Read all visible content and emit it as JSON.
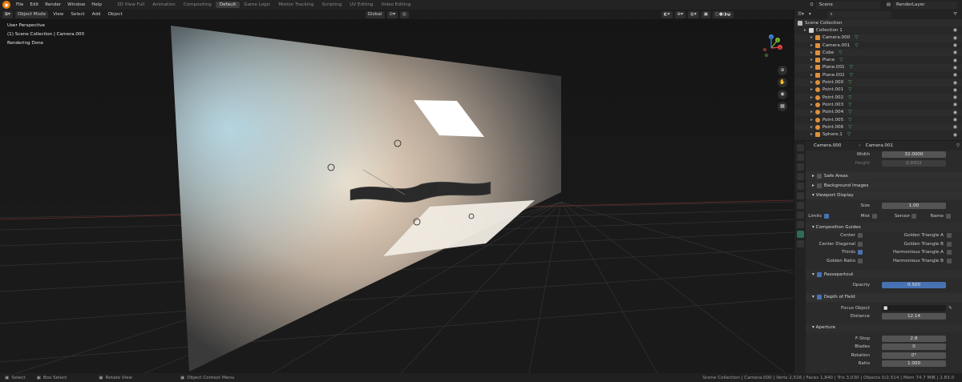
{
  "topbar": {
    "menus": [
      "File",
      "Edit",
      "Render",
      "Window",
      "Help"
    ],
    "workspaces": [
      "3D View Full",
      "Animation",
      "Compositing",
      "Default",
      "Game Logic",
      "Motion Tracking",
      "Scripting",
      "UV Editing",
      "Video Editing"
    ],
    "active_workspace": "Default",
    "scene": "Scene",
    "view_layer": "RenderLayer"
  },
  "viewport": {
    "mode": "Object Mode",
    "menus": [
      "View",
      "Select",
      "Add",
      "Object"
    ],
    "transform_orientation": "Global",
    "overlay_lines": [
      "User Perspective",
      "(1) Scene Collection | Camera.000",
      "Rendering Done"
    ],
    "gizmo_axes": [
      "X",
      "Y",
      "Z"
    ]
  },
  "statusbar": {
    "items": [
      "Select",
      "Box Select",
      "Rotate View",
      "Object Context Menu"
    ],
    "stats": "Scene Collection | Camera.000 | Verts 2,516 | Faces 1,840 | Tris 3,030 | Objects 0/2,514 | Mem 74.7 MiB | 2.83.0"
  },
  "outliner": {
    "root": "Scene Collection",
    "items": [
      {
        "name": "Collection 1",
        "type": "collection"
      },
      {
        "name": "Camera.000",
        "type": "camera"
      },
      {
        "name": "Camera.001",
        "type": "camera"
      },
      {
        "name": "Cube",
        "type": "mesh"
      },
      {
        "name": "Plane",
        "type": "mesh"
      },
      {
        "name": "Plane.001",
        "type": "mesh"
      },
      {
        "name": "Plane.002",
        "type": "mesh"
      },
      {
        "name": "Point.000",
        "type": "light"
      },
      {
        "name": "Point.001",
        "type": "light"
      },
      {
        "name": "Point.002",
        "type": "light"
      },
      {
        "name": "Point.003",
        "type": "light"
      },
      {
        "name": "Point.004",
        "type": "light"
      },
      {
        "name": "Point.005",
        "type": "light"
      },
      {
        "name": "Point.006",
        "type": "light"
      },
      {
        "name": "Sphere.1",
        "type": "mesh"
      }
    ]
  },
  "properties": {
    "object": "Camera.000",
    "data": "Camera.001",
    "width_label": "Width",
    "width_value": "32.0000",
    "height_label": "Height",
    "height_value": "0.8432",
    "panels": {
      "safe_areas": "Safe Areas",
      "background_images": "Background Images",
      "viewport_display": "Viewport Display",
      "composition_guides": "Composition Guides",
      "passepartout": "Passepartout",
      "depth_of_field": "Depth of Field",
      "aperture": "Aperture"
    },
    "size_label": "Size",
    "size_value": "1.00",
    "limits_label": "Limits",
    "mist_label": "Mist",
    "sensor_label": "Sensor",
    "name_label": "Name",
    "guides_left": [
      {
        "label": "Center",
        "on": false
      },
      {
        "label": "Center Diagonal",
        "on": false
      },
      {
        "label": "Thirds",
        "on": true
      },
      {
        "label": "Golden Ratio",
        "on": false
      }
    ],
    "guides_right": [
      {
        "label": "Golden Triangle A",
        "on": false
      },
      {
        "label": "Golden Triangle B",
        "on": false
      },
      {
        "label": "Harmonious Triangle A",
        "on": false
      },
      {
        "label": "Harmonious Triangle B",
        "on": false
      }
    ],
    "opacity_label": "Opacity",
    "opacity_value": "0.500",
    "focus_label": "Focus Object",
    "distance_label": "Distance",
    "distance_value": "12.14",
    "aperture_fields": [
      {
        "label": "F-Stop",
        "value": "2.8"
      },
      {
        "label": "Blades",
        "value": "0"
      },
      {
        "label": "Rotation",
        "value": "0°"
      },
      {
        "label": "Ratio",
        "value": "1.000"
      }
    ]
  },
  "colors": {
    "accent": "#4772b3",
    "blender_orange": "#e87d0d",
    "active_tab": "#2e6b58"
  }
}
